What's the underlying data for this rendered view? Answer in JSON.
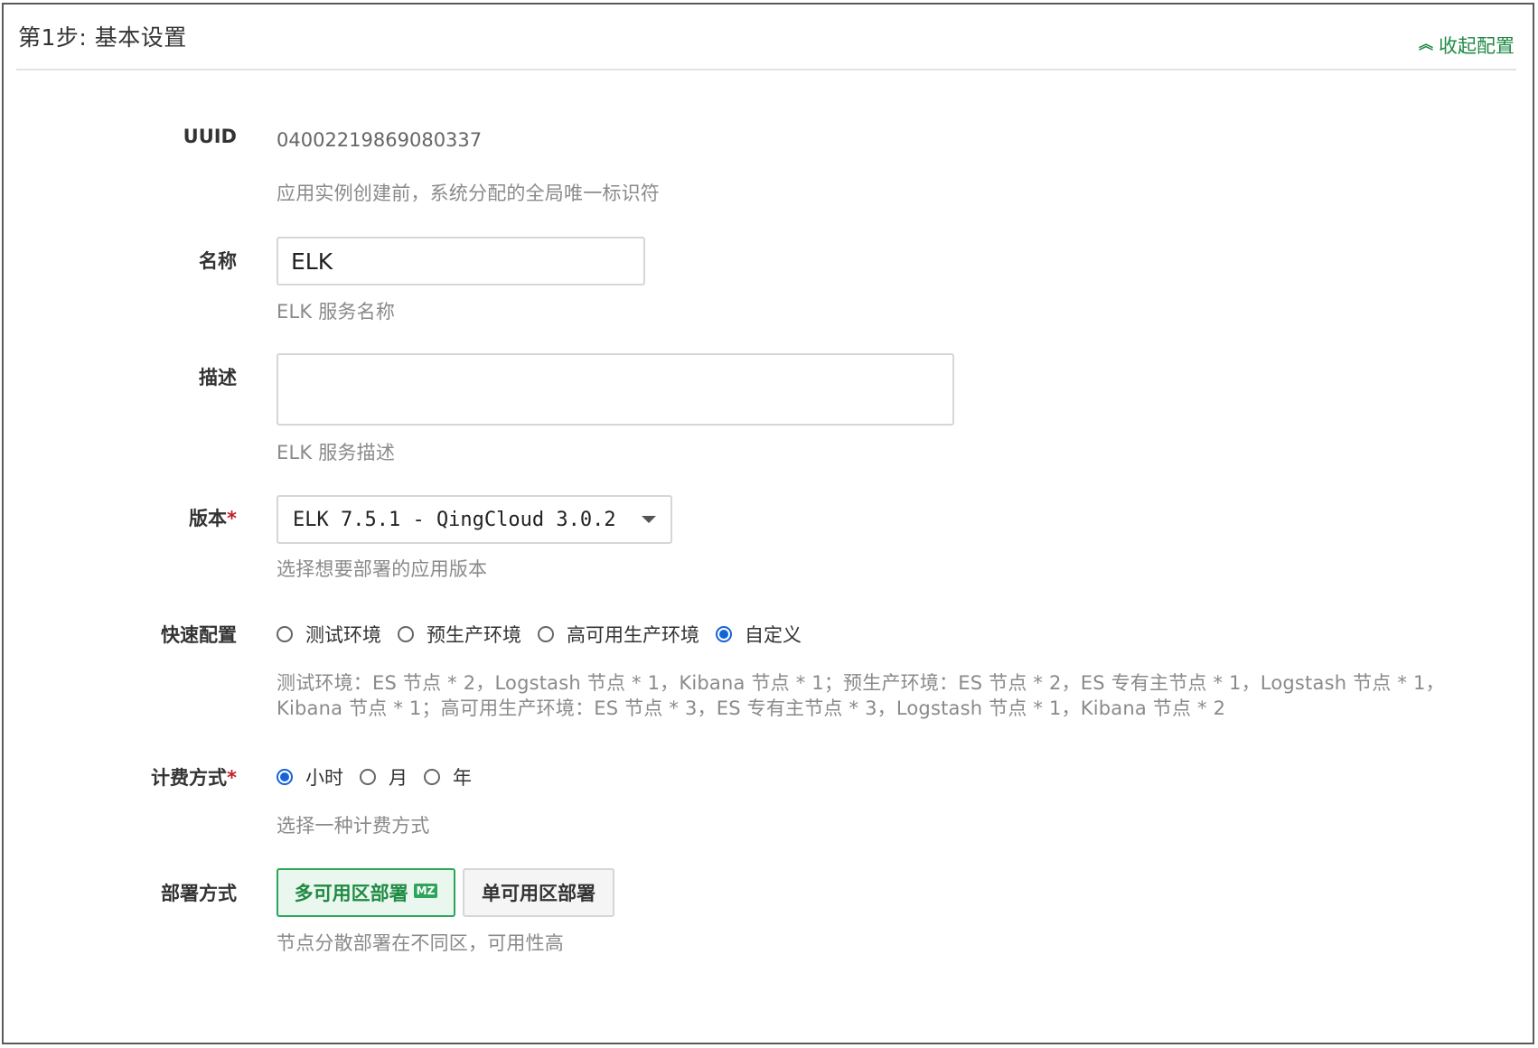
{
  "section": {
    "title": "第1步: 基本设置",
    "collapse_label": "收起配置"
  },
  "uuid": {
    "label": "UUID",
    "value": "04002219869080337",
    "help": "应用实例创建前，系统分配的全局唯一标识符"
  },
  "name": {
    "label": "名称",
    "value": "ELK",
    "help": "ELK 服务名称"
  },
  "description": {
    "label": "描述",
    "value": "",
    "help": "ELK 服务描述"
  },
  "version": {
    "label": "版本",
    "required_mark": "*",
    "selected": "ELK 7.5.1 - QingCloud 3.0.2",
    "help": "选择想要部署的应用版本"
  },
  "quick_config": {
    "label": "快速配置",
    "options": [
      {
        "label": "测试环境",
        "checked": false
      },
      {
        "label": "预生产环境",
        "checked": false
      },
      {
        "label": "高可用生产环境",
        "checked": false
      },
      {
        "label": "自定义",
        "checked": true
      }
    ],
    "help": "测试环境：ES 节点 * 2，Logstash 节点 * 1，Kibana 节点 * 1；预生产环境：ES 节点 * 2，ES 专有主节点 * 1，Logstash 节点 * 1，Kibana 节点 * 1；高可用生产环境：ES 节点 * 3，ES 专有主节点 * 3，Logstash 节点 * 1，Kibana 节点 * 2"
  },
  "billing": {
    "label": "计费方式",
    "required_mark": "*",
    "options": [
      {
        "label": "小时",
        "checked": true
      },
      {
        "label": "月",
        "checked": false
      },
      {
        "label": "年",
        "checked": false
      }
    ],
    "help": "选择一种计费方式"
  },
  "deployment": {
    "label": "部署方式",
    "multi_zone_label": "多可用区部署",
    "multi_zone_badge": "MZ",
    "single_zone_label": "单可用区部署",
    "help": "节点分散部署在不同区，可用性高"
  },
  "colors": {
    "accent_green": "#208a46",
    "radio_blue": "#1663d6",
    "required_red": "#c0202a"
  }
}
